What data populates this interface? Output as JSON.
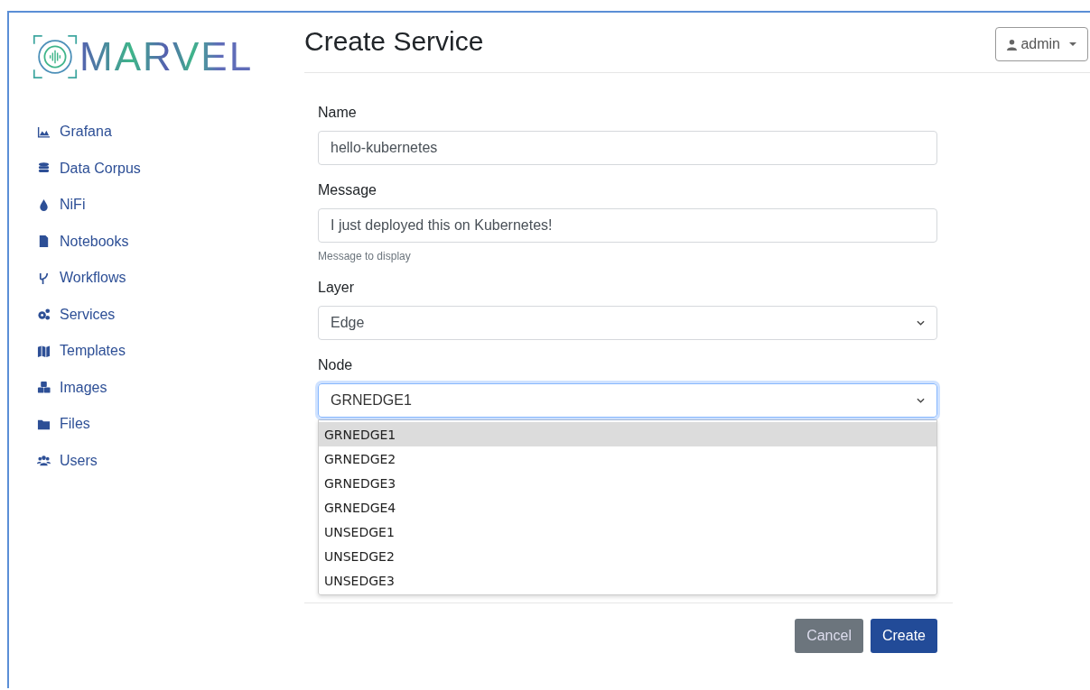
{
  "logo": {
    "text": "MARVEL"
  },
  "sidebar": {
    "items": [
      {
        "label": "Grafana"
      },
      {
        "label": "Data Corpus"
      },
      {
        "label": "NiFi"
      },
      {
        "label": "Notebooks"
      },
      {
        "label": "Workflows"
      },
      {
        "label": "Services"
      },
      {
        "label": "Templates"
      },
      {
        "label": "Images"
      },
      {
        "label": "Files"
      },
      {
        "label": "Users"
      }
    ]
  },
  "header": {
    "title": "Create Service",
    "user_menu": "admin"
  },
  "form": {
    "name": {
      "label": "Name",
      "value": "hello-kubernetes"
    },
    "message": {
      "label": "Message",
      "value": "I just deployed this on Kubernetes!",
      "help": "Message to display"
    },
    "layer": {
      "label": "Layer",
      "value": "Edge"
    },
    "node": {
      "label": "Node",
      "value": "GRNEDGE1",
      "expanded": true,
      "options": [
        {
          "label": "GRNEDGE1",
          "selected": true
        },
        {
          "label": "GRNEDGE2",
          "selected": false
        },
        {
          "label": "GRNEDGE3",
          "selected": false
        },
        {
          "label": "GRNEDGE4",
          "selected": false
        },
        {
          "label": "UNSEDGE1",
          "selected": false
        },
        {
          "label": "UNSEDGE2",
          "selected": false
        },
        {
          "label": "UNSEDGE3",
          "selected": false
        }
      ]
    }
  },
  "buttons": [
    {
      "label": "Cancel",
      "kind": "secondary"
    },
    {
      "label": "Create",
      "kind": "primary"
    }
  ]
}
